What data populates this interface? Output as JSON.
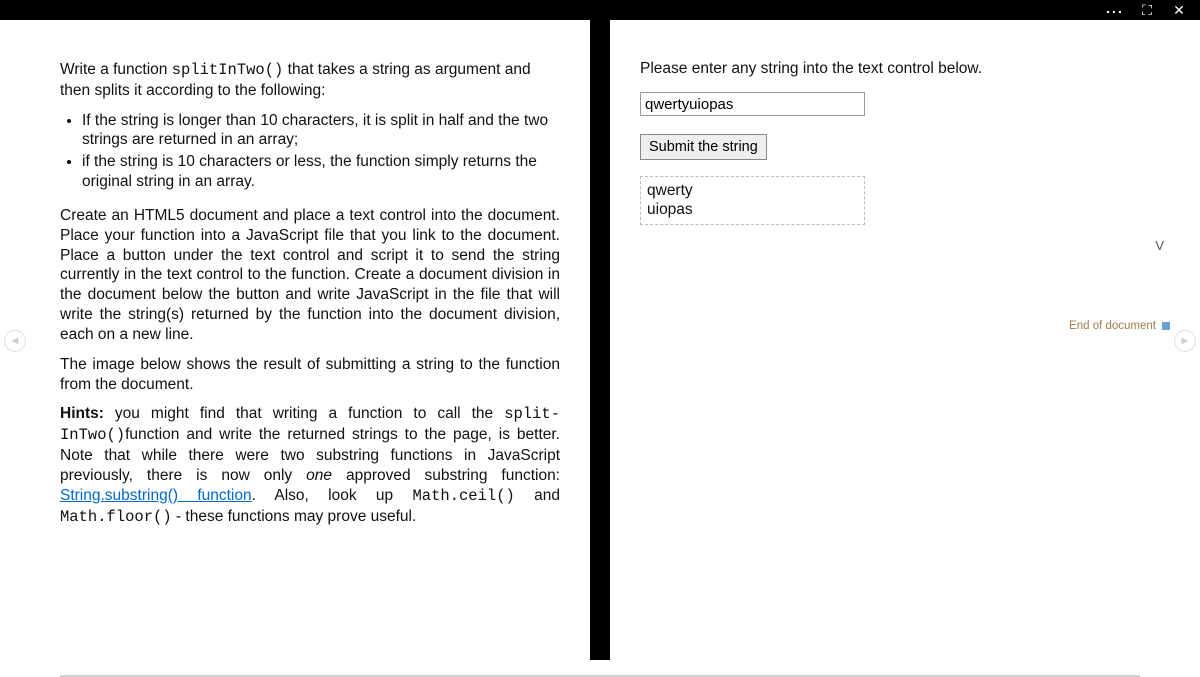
{
  "topbar": {
    "more_icon": "...",
    "fullscreen_icon": "⛶",
    "close_icon": "✕"
  },
  "nav": {
    "prev": "◄",
    "next": "►"
  },
  "left": {
    "intro_pre": "Write a function ",
    "intro_code": "splitInTwo()",
    "intro_post": " that takes a string as argument and then splits it according to the following:",
    "bullets": [
      "If the string is longer than 10 characters, it is split in half and the two strings are returned in an array;",
      "if the string is 10 characters or less, the function simply returns the original string in an array."
    ],
    "para2": "Create an HTML5 document and place a text control into the document. Place your function into a JavaScript file that you link to the document. Place a button under the text control and script it to send the string currently in the text control to the function. Create a document division in the document below the button and write JavaScript in the file that will write the string(s) returned by the function into the document division, each on a new line.",
    "para3": "The image below shows the result of submitting a string to the function from the document.",
    "hints_label": "Hints:",
    "hints_a": " you might find that writing a function to call the ",
    "hints_code1": "split-InTwo()",
    "hints_b": "function and write the returned strings to the page, is better. Note that while there were two substring functions in JavaScript previously, there is now only ",
    "hints_em": "one",
    "hints_c": " approved substring function: ",
    "hints_link": "String.substring() function",
    "hints_d": ". Also, look up ",
    "hints_code2": "Math.ceil()",
    "hints_e": " and ",
    "hints_code3": "Math.floor()",
    "hints_f": " - these functions may prove useful."
  },
  "right": {
    "prompt": "Please enter any string into the text control below.",
    "input_value": "qwertyuiopas",
    "submit_label": "Submit the string",
    "output_lines": [
      "qwerty",
      "uiopas"
    ],
    "page_mark": "V",
    "end_label": "End of document"
  }
}
